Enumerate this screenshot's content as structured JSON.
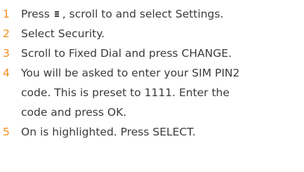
{
  "steps": [
    {
      "number": "1",
      "text_before_icon": "Press",
      "icon": "menu-icon",
      "text_after_icon": ", scroll to and select Settings."
    },
    {
      "number": "2",
      "lines": [
        "Select Security."
      ]
    },
    {
      "number": "3",
      "lines": [
        "Scroll to Fixed Dial and press CHANGE."
      ]
    },
    {
      "number": "4",
      "lines": [
        "You will be asked to enter your SIM PIN2",
        "code. This is preset to 1111. Enter the",
        "code and press OK."
      ]
    },
    {
      "number": "5",
      "lines": [
        "On is highlighted. Press SELECT."
      ]
    }
  ],
  "colors": {
    "step_number": "#f28e1c",
    "body_text": "#3a3a3a"
  }
}
